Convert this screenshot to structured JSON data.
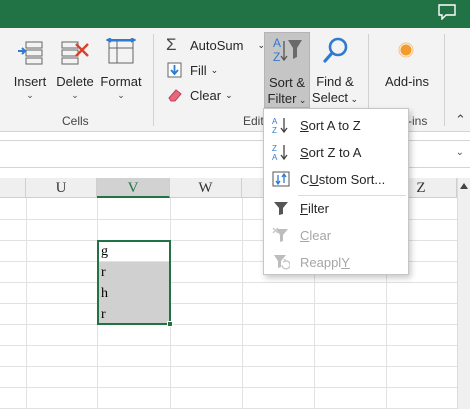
{
  "ribbon": {
    "cells_group": {
      "label": "Cells",
      "insert_label": "Insert",
      "delete_label": "Delete",
      "format_label": "Format"
    },
    "editing_group": {
      "label_visible": "Edit",
      "autosum_label": "AutoSum",
      "fill_label": "Fill",
      "clear_label": "Clear",
      "sort_filter_line1": "Sort &",
      "sort_filter_line2": "Filter",
      "find_select_line1": "Find &",
      "find_select_line2": "Select"
    },
    "addins_group": {
      "addins_label": "Add-ins",
      "label_visible": "-ins"
    }
  },
  "columns": [
    "U",
    "V",
    "W",
    "Z"
  ],
  "active_column": "V",
  "cells": [
    {
      "value": "g",
      "selected": false
    },
    {
      "value": "r",
      "selected": true
    },
    {
      "value": "h",
      "selected": true
    },
    {
      "value": "r",
      "selected": true
    }
  ],
  "sort_filter_menu": {
    "items": [
      {
        "first": "S",
        "rest": "ort A to Z",
        "icon": "sort-a-z-icon",
        "enabled": true
      },
      {
        "first": "S",
        "rest": "ort Z to A",
        "icon": "sort-z-a-icon",
        "enabled": true
      },
      {
        "first": "U",
        "rest": "stom Sort...",
        "pre": "C",
        "icon": "custom-sort-icon",
        "enabled": true
      },
      {
        "first": "F",
        "rest": "ilter",
        "icon": "filter-icon",
        "enabled": true
      },
      {
        "first": "C",
        "rest": "lear",
        "icon": "clear-filter-icon",
        "enabled": false
      },
      {
        "first": "Y",
        "rest": "",
        "pre": "Reappl",
        "icon": "reapply-icon",
        "enabled": false
      }
    ]
  },
  "colors": {
    "brand": "#217346",
    "ribbon_bg": "#f3f3f3",
    "sort_highlight": "#c5c5c5"
  }
}
